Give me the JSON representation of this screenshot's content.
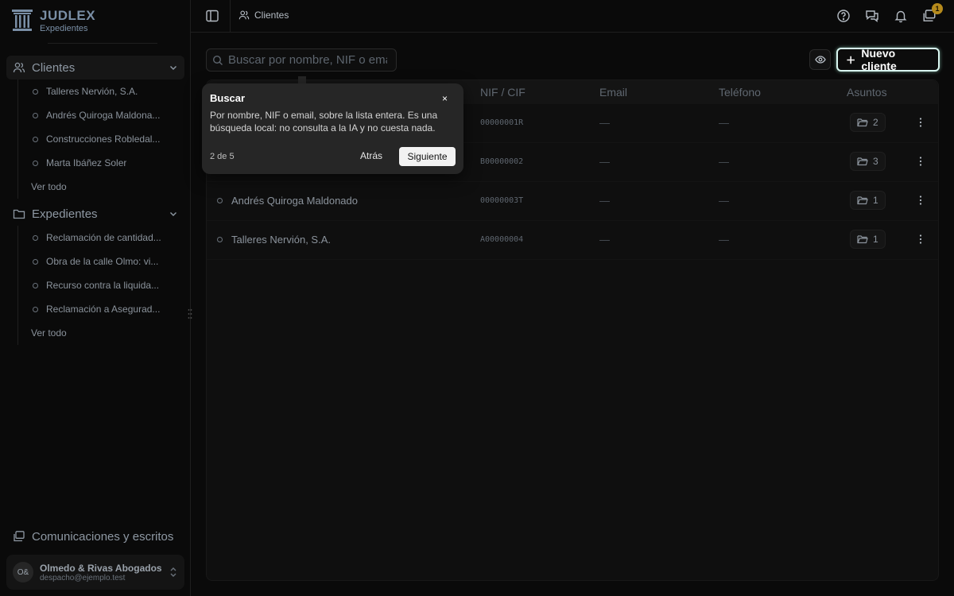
{
  "brand": {
    "title": "JUDLEX",
    "subtitle": "Expedientes"
  },
  "sidebar": {
    "clientes": {
      "label": "Clientes",
      "items": [
        "Talleres Nervión, S.A.",
        "Andrés Quiroga Maldona...",
        "Construcciones Robledal...",
        "Marta Ibáñez Soler"
      ],
      "more": "Ver todo"
    },
    "expedientes": {
      "label": "Expedientes",
      "items": [
        "Reclamación de cantidad...",
        "Obra de la calle Olmo: vi...",
        "Recurso contra la liquida...",
        "Reclamación a Asegurad..."
      ],
      "more": "Ver todo"
    },
    "comms_label": "Comunicaciones y escritos",
    "account": {
      "initials": "O&",
      "name": "Olmedo & Rivas Abogados",
      "email": "despacho@ejemplo.test"
    }
  },
  "header": {
    "breadcrumb": "Clientes",
    "badge_count": "1"
  },
  "toolbar": {
    "search_placeholder": "Buscar por nombre, NIF o email.",
    "new_label": "Nuevo cliente"
  },
  "table": {
    "headers": {
      "nif": "NIF / CIF",
      "email": "Email",
      "phone": "Teléfono",
      "matters": "Asuntos"
    },
    "rows": [
      {
        "name": "",
        "nif": "00000001R",
        "email": "—",
        "phone": "—",
        "matters": "2"
      },
      {
        "name": "",
        "nif": "B00000002",
        "email": "—",
        "phone": "—",
        "matters": "3"
      },
      {
        "name": "Andrés Quiroga Maldonado",
        "nif": "00000003T",
        "email": "—",
        "phone": "—",
        "matters": "1"
      },
      {
        "name": "Talleres Nervión, S.A.",
        "nif": "A00000004",
        "email": "—",
        "phone": "—",
        "matters": "1"
      }
    ]
  },
  "tour": {
    "title": "Buscar",
    "close": "×",
    "body": "Por nombre, NIF o email, sobre la lista entera. Es una búsqueda local: no consulta a la IA y no cuesta nada.",
    "progress": "2 de 5",
    "back": "Atrás",
    "next": "Siguiente"
  }
}
